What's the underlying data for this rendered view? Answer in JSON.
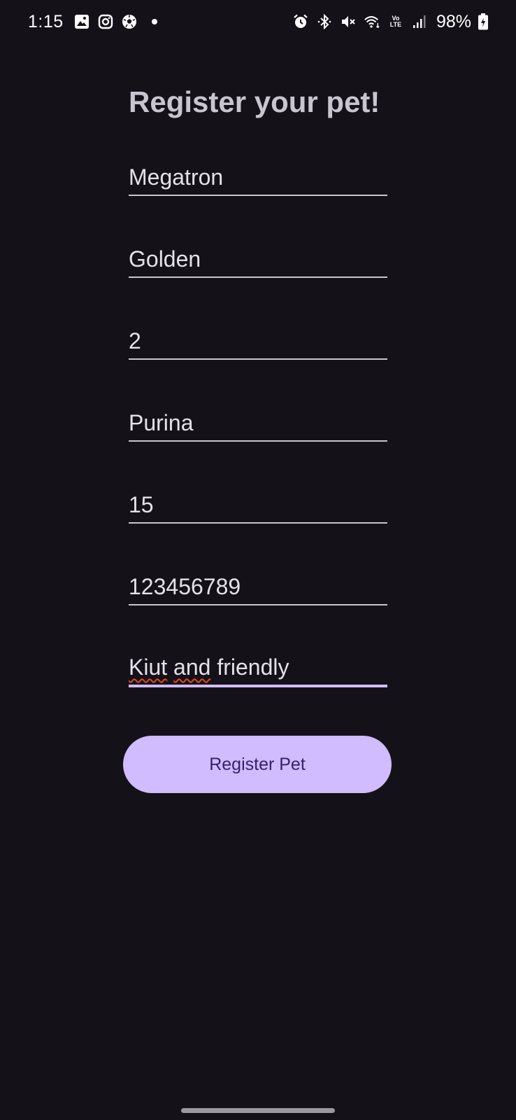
{
  "status_bar": {
    "time": "1:15",
    "battery": "98%",
    "left_icons": [
      "gallery-icon",
      "instagram-icon",
      "soccer-ball-icon",
      "notification-dot"
    ],
    "right_icons": [
      "alarm-icon",
      "bluetooth-icon",
      "mute-icon",
      "wifi-icon",
      "volte-icon",
      "signal-icon",
      "battery-charging-icon"
    ],
    "volte_label": "Vo LTE"
  },
  "form": {
    "title": "Register your pet!",
    "fields": [
      {
        "value": "Megatron"
      },
      {
        "value": "Golden"
      },
      {
        "value": "2"
      },
      {
        "value": "Purina"
      },
      {
        "value": "15"
      },
      {
        "value": "123456789"
      },
      {
        "value_parts": [
          "Kiut",
          " ",
          "and",
          " friendly"
        ]
      }
    ],
    "submit_label": "Register Pet"
  },
  "colors": {
    "background": "#141218",
    "button": "#d0bcff",
    "button_text": "#381e72",
    "title": "#cac4d0",
    "spellcheck": "#e8461c"
  }
}
